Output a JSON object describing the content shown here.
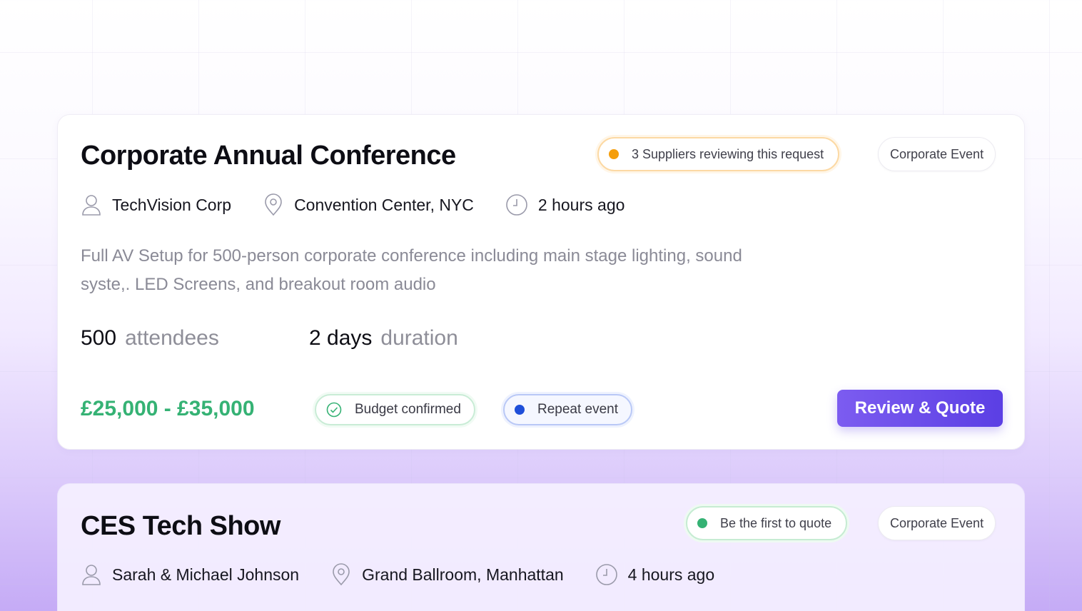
{
  "requests": [
    {
      "title": "Corporate Annual Conference",
      "status": {
        "text": "3 Suppliers reviewing this request",
        "color": "#f59e0b"
      },
      "category": "Corporate Event",
      "client": "TechVision Corp",
      "location": "Convention Center, NYC",
      "posted": "2 hours ago",
      "description": "Full AV Setup for 500-person corporate conference including main stage lighting, sound syste,. LED Screens, and breakout room audio",
      "attendees": {
        "value": "500",
        "label": "attendees"
      },
      "duration": {
        "value": "2 days",
        "label": "duration"
      },
      "budget": "£25,000 - £35,000",
      "budget_tag": "Budget confirmed",
      "repeat_tag": "Repeat event",
      "cta": "Review & Quote"
    },
    {
      "title": "CES Tech Show",
      "status": {
        "text": "Be the first to quote",
        "color": "#35b274"
      },
      "category": "Corporate Event",
      "client": "Sarah & Michael Johnson",
      "location": "Grand Ballroom, Manhattan",
      "posted": "4 hours ago"
    }
  ],
  "colors": {
    "accent": "#6a4bea",
    "price_green": "#35b274",
    "repeat_blue": "#1f4fd9"
  },
  "icons": [
    "user-icon",
    "map-pin-icon",
    "clock-icon",
    "check-circle-icon"
  ]
}
